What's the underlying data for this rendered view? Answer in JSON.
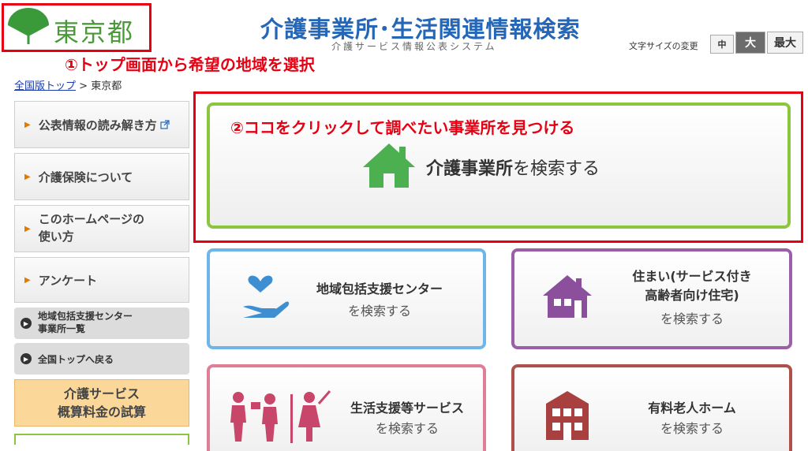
{
  "header": {
    "logo_text": "東京都",
    "title": "介護事業所･生活関連情報検索",
    "subtitle": "介護サービス情報公表システム",
    "font_size_label": "文字サイズの変更",
    "font_sizes": [
      "中",
      "大",
      "最大"
    ]
  },
  "annotations": {
    "step1": "①トップ画面から希望の地域を選択",
    "step2": "②ココをクリックして調べたい事業所を見つける"
  },
  "breadcrumb": {
    "home": "全国版トップ",
    "separator": " > ",
    "current": "東京都"
  },
  "sidebar": {
    "items": [
      {
        "label": "公表情報の読み解き方"
      },
      {
        "label": "介護保険について"
      },
      {
        "label_line1": "このホームページの",
        "label_line2": "使い方"
      },
      {
        "label": "アンケート"
      }
    ],
    "links": [
      {
        "line1": "地域包括支援センター",
        "line2": "事業所一覧"
      },
      {
        "line1": "全国トップへ戻る"
      }
    ],
    "estimate": {
      "line1": "介護サービス",
      "line2": "概算料金の試算"
    }
  },
  "main_card": {
    "bold": "介護事業所",
    "rest": "を検索する"
  },
  "cards": {
    "blue": {
      "title": "地域包括支援センター",
      "sub": "を検索する"
    },
    "purple": {
      "title1": "住まい(サービス付き",
      "title2": "高齢者向け住宅)",
      "sub": "を検索する"
    },
    "pink": {
      "title": "生活支援等サービス",
      "sub": "を検索する"
    },
    "maroon": {
      "title": "有料老人ホーム",
      "sub": "を検索する"
    }
  },
  "colors": {
    "annotation_red": "#e60012",
    "green": "#4a9a3a",
    "title_blue": "#2466b8",
    "card_blue": "#6fb6e8",
    "card_purple": "#9b5ea8",
    "card_pink": "#e07d97",
    "card_maroon": "#b0504b"
  }
}
